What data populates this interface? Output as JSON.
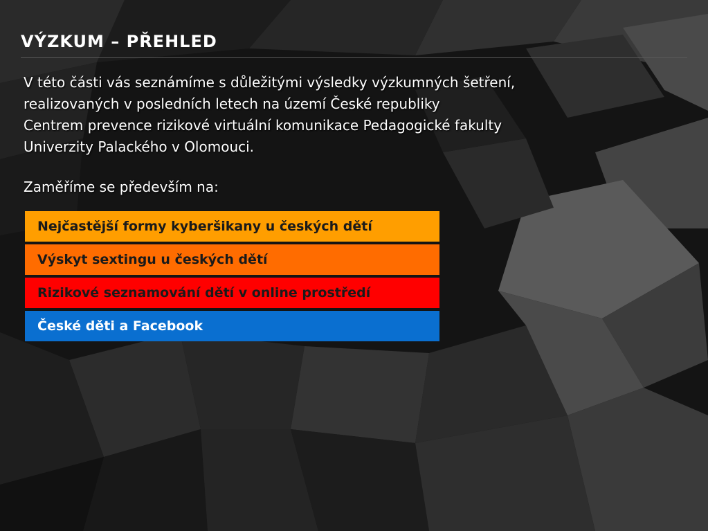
{
  "slide": {
    "title": "VÝZKUM – PŘEHLED",
    "intro_lines": [
      "V této části vás seznámíme s důležitými výsledky výzkumných šetření,",
      "realizovaných v posledních letech na území České republiky",
      "Centrem prevence rizikové virtuální komunikace Pedagogické fakulty",
      "Univerzity Palackého v Olomouci."
    ],
    "focus_label": "Zaměříme se především na:",
    "topics": [
      {
        "label": "Nejčastější formy kyberšikany u českých dětí",
        "color": "#ff9e00",
        "text_color": "#1a1a1a"
      },
      {
        "label": "Výskyt sextingu u českých dětí",
        "color": "#ff6c00",
        "text_color": "#1a1a1a"
      },
      {
        "label": "Rizikové seznamování dětí v online prostředí",
        "color": "#ff0000",
        "text_color": "#1a1a1a"
      },
      {
        "label": "České děti a Facebook",
        "color": "#0a6fd0",
        "text_color": "#ffffff"
      }
    ]
  }
}
